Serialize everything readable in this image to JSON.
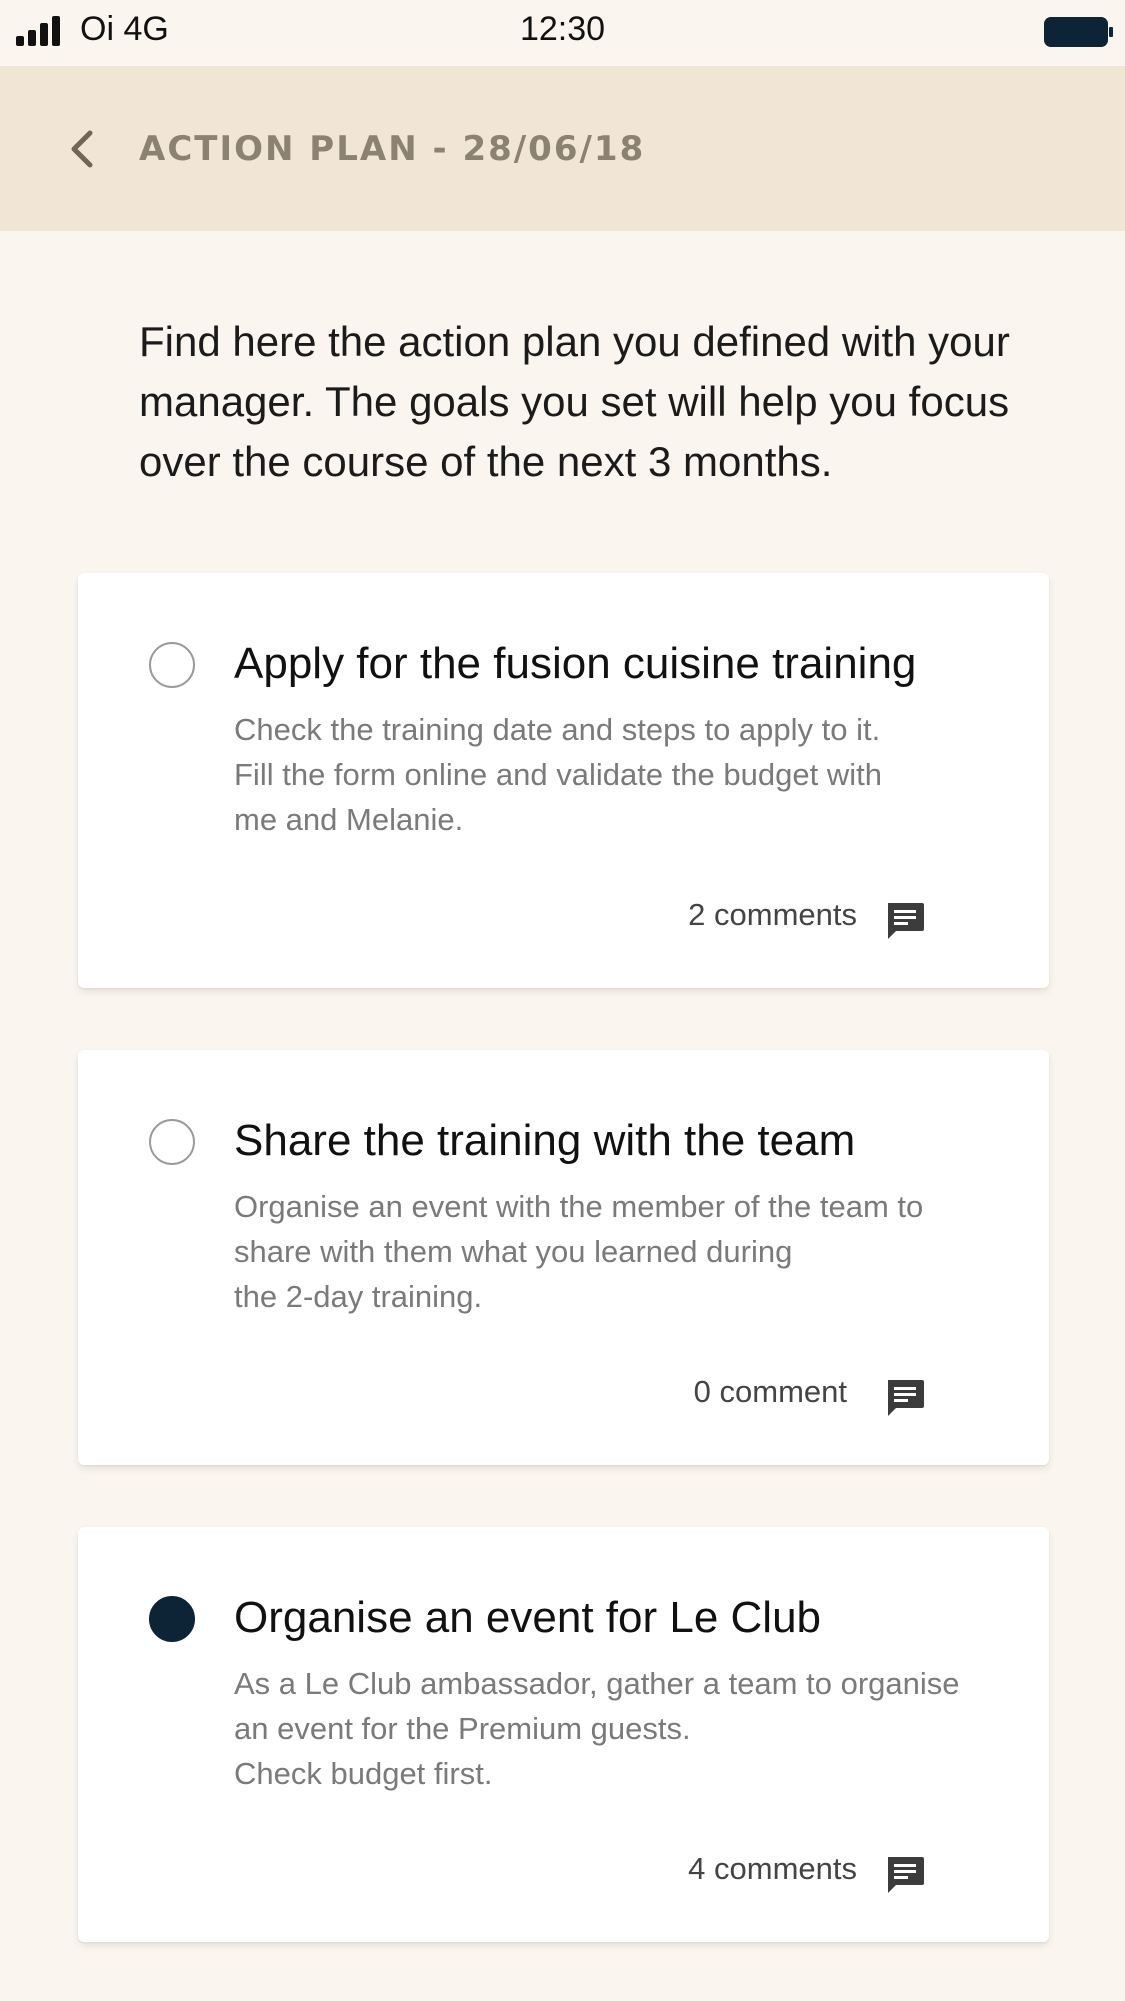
{
  "status_bar": {
    "carrier": "Oi 4G",
    "time": "12:30",
    "icons": [
      "signal-icon",
      "battery-icon"
    ]
  },
  "header": {
    "title": "ACTION PLAN - 28/06/18",
    "back_icon": "back-chevron-icon",
    "background_color": "#f1e6d6"
  },
  "intro": "Find here the action plan you defined with your manager. The goals you set will help you focus over the course of the next 3 months.",
  "goals": [
    {
      "title": "Apply for the fusion cuisine training",
      "description": "Check the training date and steps to apply to it.\nFill the form online and validate the budget with\nme and Melanie.",
      "comments": "2 comments",
      "completed": false
    },
    {
      "title": "Share the training  with the team",
      "description": "Organise an event with the member of the team to\nshare with them what you learned during\nthe 2-day training.",
      "comments": "0 comment",
      "completed": false
    },
    {
      "title": "Organise an event for Le Club",
      "description": "As a Le Club ambassador, gather a team to organise\nan event for the Premium guests.\nCheck budget first.",
      "comments": "4 comments",
      "completed": true
    }
  ],
  "colors": {
    "background": "#faf5ef",
    "checked_radio": "#0d2436",
    "header_text": "#8c8270"
  }
}
